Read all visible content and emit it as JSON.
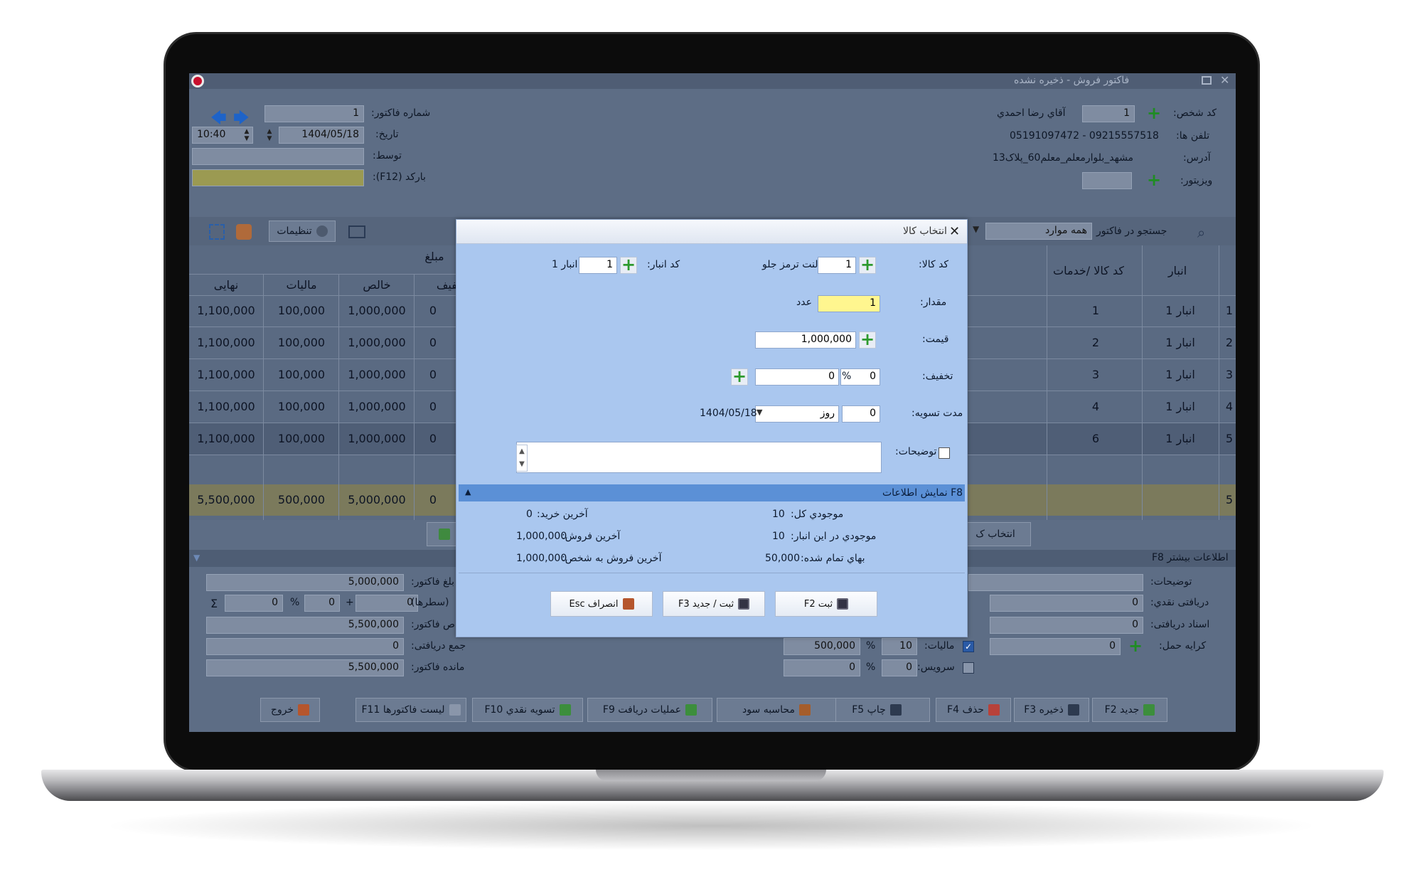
{
  "window": {
    "title": "فاکتور فروش - ذخیره نشده"
  },
  "header": {
    "invoice_no_label": "شماره فاکتور:",
    "invoice_no": "1",
    "date_label": "تاریخ:",
    "date": "1404/05/18",
    "time": "10:40",
    "by_label": "توسط:",
    "barcode_label": "بارکد (F12):",
    "person_code_label": "کد شخص:",
    "person_code": "1",
    "person_name": "آقاي رضا احمدي",
    "phones_label": "تلفن ها:",
    "phones": "05191097472 - 09215557518",
    "address_label": "آدرس:",
    "address": "مشهد_بلوارمعلم_معلم60_پلاک13",
    "visitor_label": "ويزيتور:"
  },
  "toolbar": {
    "settings": "تنظیمات",
    "search_label": "جستجو در فاکتور",
    "search_scope": "همه موارد"
  },
  "table": {
    "group_header": "مبلغ",
    "headers": {
      "final": "نهایی",
      "tax": "مالیات",
      "net": "خالص",
      "discount": "تخفیف",
      "code": "کد کالا /خدمات",
      "warehouse": "انبار"
    },
    "rows": [
      {
        "final": "1,100,000",
        "tax": "100,000",
        "net": "1,000,000",
        "discount": "0",
        "code": "1",
        "warehouse": "انبار 1",
        "idx": "1"
      },
      {
        "final": "1,100,000",
        "tax": "100,000",
        "net": "1,000,000",
        "discount": "0",
        "code": "2",
        "warehouse": "انبار 1",
        "idx": "2"
      },
      {
        "final": "1,100,000",
        "tax": "100,000",
        "net": "1,000,000",
        "discount": "0",
        "code": "3",
        "warehouse": "انبار 1",
        "idx": "3"
      },
      {
        "final": "1,100,000",
        "tax": "100,000",
        "net": "1,000,000",
        "discount": "0",
        "code": "4",
        "warehouse": "انبار 1",
        "idx": "4"
      },
      {
        "final": "1,100,000",
        "tax": "100,000",
        "net": "1,000,000",
        "discount": "0",
        "code": "6",
        "warehouse": "انبار 1",
        "idx": "5"
      }
    ],
    "totals": {
      "final": "5,500,000",
      "tax": "500,000",
      "net": "5,000,000",
      "discount": "0",
      "idx": "5"
    }
  },
  "select_item_button": "انتخاب ک",
  "more_info": "اطلاعات بیشتر F8",
  "summary": {
    "invoice_amount_label": "بلغ فاکتور:",
    "invoice_amount": "5,000,000",
    "rows_label": "(سطرها)",
    "rows_pct": "0",
    "rows_amount": "0",
    "rows_x": "0",
    "invoice_total_label": "ص فاکتور:",
    "invoice_total": "5,500,000",
    "received_total_label": "جمع دریافتی:",
    "received_total": "0",
    "remaining_label": "مانده فاکتور:",
    "remaining": "5,500,000",
    "notes_label": "توضیحات:",
    "cash_received_label": "دریافتی نقدي:",
    "cash_received": "0",
    "docs_received_label": "اسناد دریافتی:",
    "docs_received": "0",
    "shipping_label": "کرايه حمل:",
    "shipping": "0",
    "tax_label": "مالیات:",
    "tax_pct": "10",
    "tax_amount": "500,000",
    "service_label": "سرويس:",
    "service_pct": "0",
    "service_amount": "0"
  },
  "bottom_buttons": [
    "جدید F2",
    "ذخیره F3",
    "حذف F4",
    "چاپ F5",
    "محاسبه سود",
    "عملیات دریافت F9",
    "تسويه نقدي F10",
    "لیست فاکتورها F11",
    "خروج"
  ],
  "dialog": {
    "title": "انتخاب کالا",
    "item_code_label": "کد کالا:",
    "item_code": "1",
    "item_name": "لنت ترمز جلو",
    "warehouse_code_label": "کد انبار:",
    "warehouse_code": "1",
    "warehouse_name": "انبار 1",
    "qty_label": "مقدار:",
    "qty": "1",
    "unit": "عدد",
    "price_label": "قیمت:",
    "price": "1,000,000",
    "discount_label": "تخفیف:",
    "discount_pct": "0",
    "pct_sign": "%",
    "discount_amount": "0",
    "settle_label": "مدت تسويه:",
    "settle_days": "0",
    "settle_unit": "روز",
    "settle_date": "1404/05/18",
    "notes_label": "توضیحات:",
    "info_bar": "F8 نمایش اطلاعات",
    "stock_total_label": "موجودي کل:",
    "stock_total": "10",
    "stock_here_label": "موجودي در اين انبار:",
    "stock_here": "10",
    "cost_label": "بهاي تمام شده:",
    "cost": "50,000",
    "last_buy_label": "آخرین خرید:",
    "last_buy": "0",
    "last_sell_label": "آخرین فروش:",
    "last_sell": "1,000,000",
    "last_sell_person_label": "آخرین فروش به شخص:",
    "last_sell_person": "1,000,000",
    "btn_save": "ثبت F2",
    "btn_save_new": "ثبت / جدید F3",
    "btn_cancel": "انصراف Esc"
  }
}
